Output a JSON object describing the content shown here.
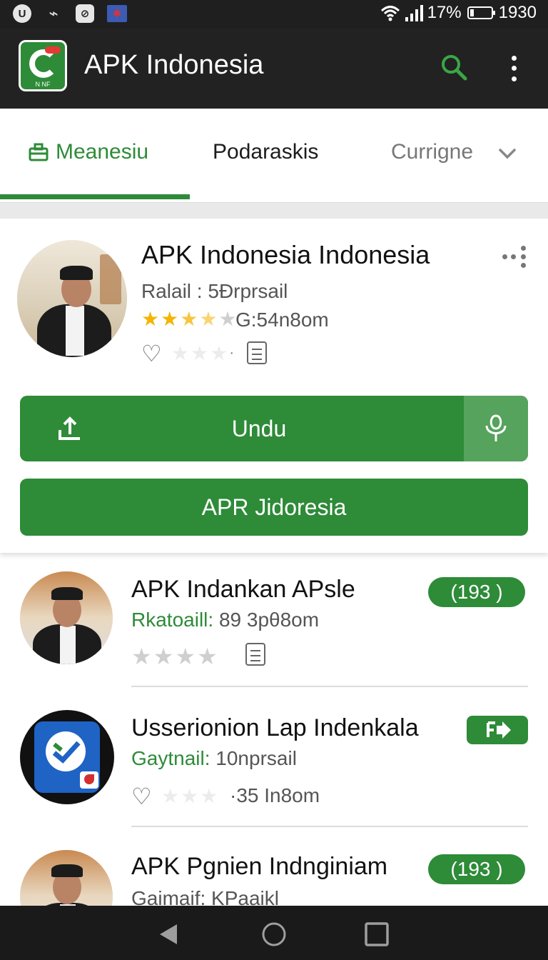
{
  "status_bar": {
    "battery": "17%",
    "time": "1930",
    "icons": [
      "notification-icon",
      "sound-icon",
      "app-icon",
      "flag-icon",
      "wifi-icon",
      "signal-icon",
      "battery-icon"
    ]
  },
  "app_bar": {
    "title": "APK Indonesia",
    "logo_text": "N NF",
    "icons": [
      "search-icon",
      "more-vert-icon"
    ],
    "accent": "#2e8b38"
  },
  "tabs": [
    {
      "label": "Meanesiu",
      "active": true
    },
    {
      "label": "Podaraskis",
      "active": false
    },
    {
      "label": "Currigne",
      "active": false
    }
  ],
  "featured": {
    "title": "APK Indonesia Indonesia",
    "meta1": "Ralail : 5Ðrprsail",
    "rating_text": "G:54n8om",
    "rating_stars": 3.5,
    "download_label": "Undu",
    "second_button_label": "APR Jidoresia"
  },
  "list": [
    {
      "title": "APK Indankan APsle",
      "meta_label": "Rkatoaill:",
      "meta_value": "89 3pθ8om",
      "badge": "(193 )"
    },
    {
      "title": "Usserionion Lap Indenkala",
      "meta_label": "Gaytnail:",
      "meta_value": "10nprsail",
      "rating_text": "·35 In8om",
      "badge_icon": "forward-arrow-icon"
    },
    {
      "title": "APK Pgnien Indnginiam",
      "meta_label": "Gaimaif:",
      "meta_value": "KPaaikl",
      "badge": "(193 )"
    }
  ],
  "nav_bar": {
    "icons": [
      "back-icon",
      "home-icon",
      "recents-icon"
    ]
  }
}
